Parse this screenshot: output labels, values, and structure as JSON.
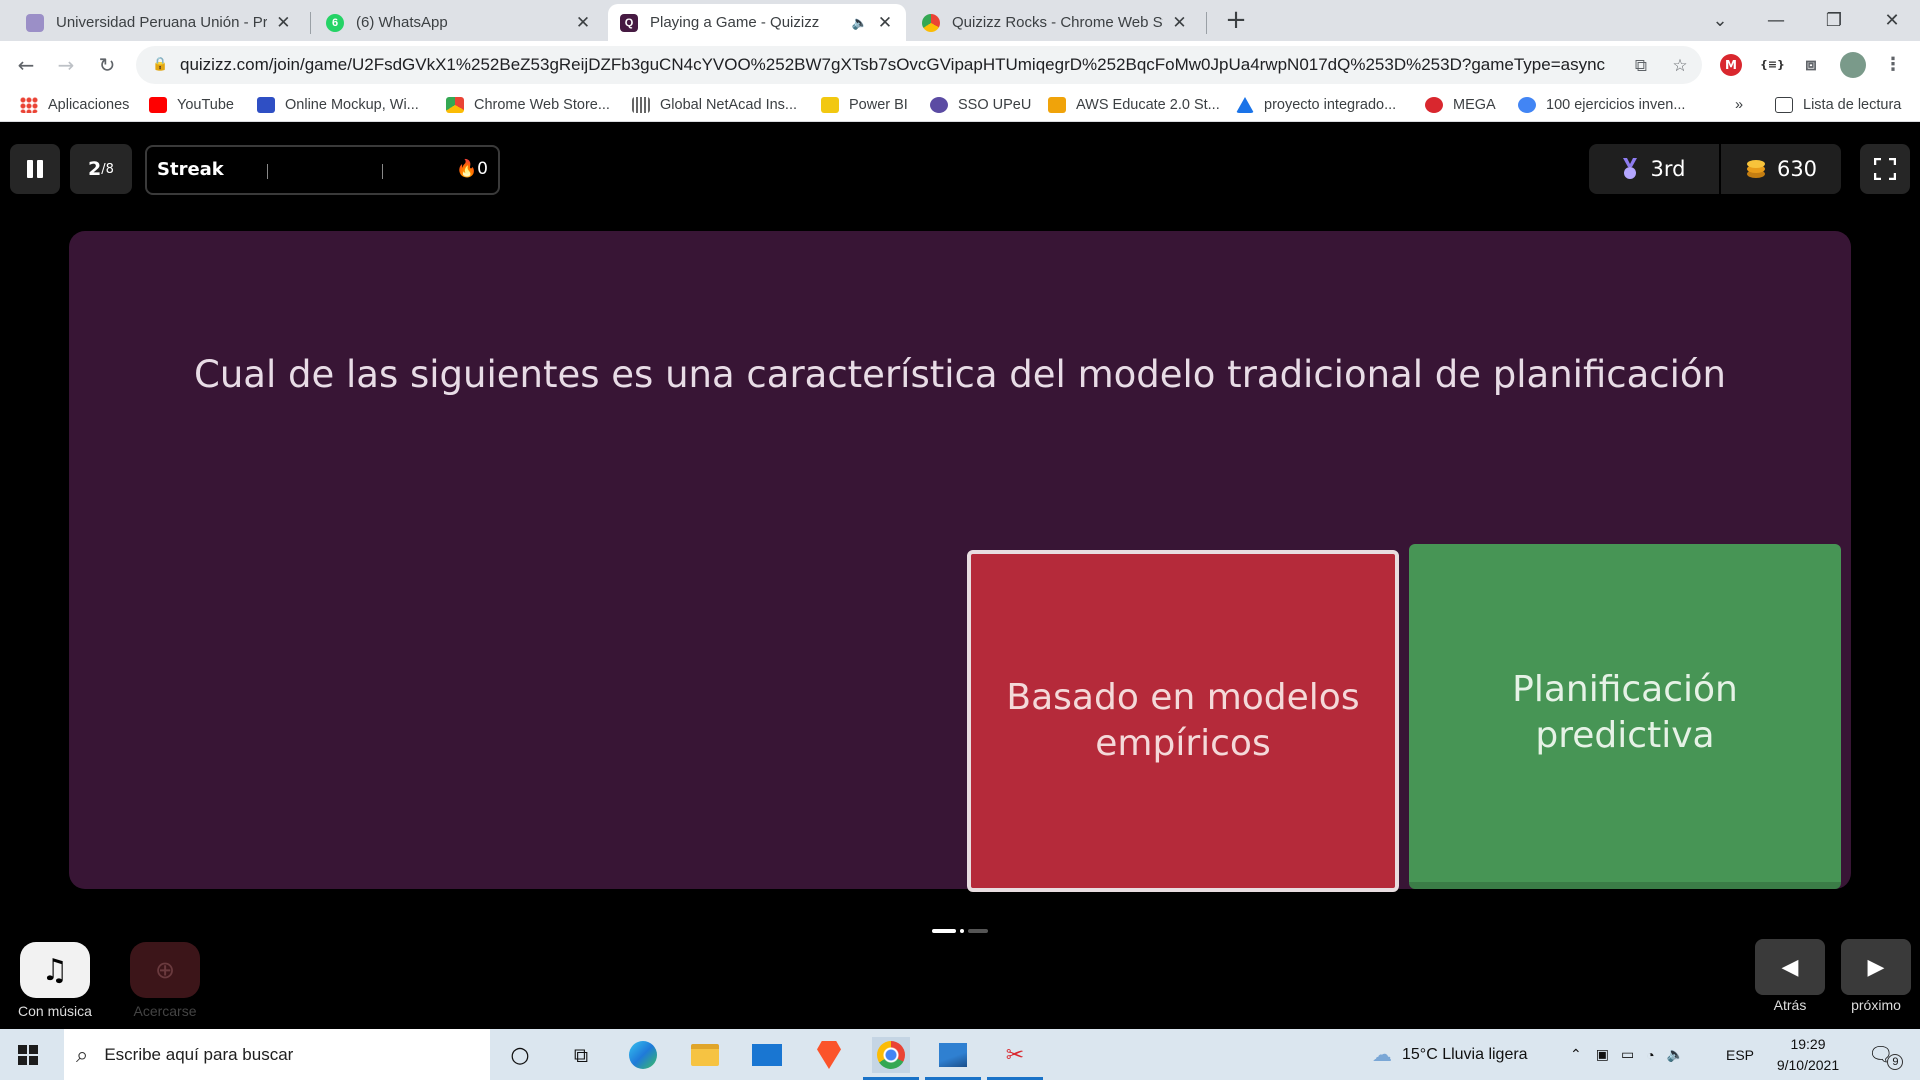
{
  "browser": {
    "tabs": [
      {
        "title": "Universidad Peruana Unión - Pre",
        "favicon_color": "#9b8fc7"
      },
      {
        "title": "(6) WhatsApp",
        "favicon_color": "#25d366"
      },
      {
        "title": "Playing a Game - Quizizz",
        "favicon_color": "#461a42",
        "active": true
      },
      {
        "title": "Quizizz Rocks - Chrome Web Sto",
        "favicon_color": "#e8a33b"
      }
    ],
    "url": "quizizz.com/join/game/U2FsdGVkX1%252BeZ53gReijDZFb3guCN4cYVOO%252BW7gXTsb7sOvcGVipapHTUmiqegrD%252BqcFoMw0JpUa4rwpN017dQ%253D%253D?gameType=async",
    "bookmarks": [
      {
        "label": "Aplicaciones",
        "color": "#ea4335"
      },
      {
        "label": "YouTube",
        "color": "#ff0000"
      },
      {
        "label": "Online Mockup, Wi...",
        "color": "#2f4fc4"
      },
      {
        "label": "Chrome Web Store...",
        "color": "#e8a33b"
      },
      {
        "label": "Global NetAcad Ins...",
        "color": "#666666"
      },
      {
        "label": "Power BI",
        "color": "#f2c811"
      },
      {
        "label": "SSO UPeU",
        "color": "#5b4ba3"
      },
      {
        "label": "AWS Educate 2.0 St...",
        "color": "#f0a30a"
      },
      {
        "label": "proyecto integrado...",
        "color": "#1a73e8"
      },
      {
        "label": "MEGA",
        "color": "#d9272e"
      },
      {
        "label": "100 ejercicios inven...",
        "color": "#4285f4"
      }
    ],
    "bookmarks_overflow": "»",
    "reading_list": "Lista de lectura"
  },
  "game": {
    "question_counter": {
      "current": "2",
      "total": "/8"
    },
    "streak": {
      "label": "Streak",
      "count": "0"
    },
    "rank": "3rd",
    "coins": "630",
    "question": "Cual de las siguientes es una característica del modelo tradicional de planificación",
    "options": [
      {
        "text": "Basado en modelos empíricos",
        "color": "#b52a3a"
      },
      {
        "text": "Planificación predictiva",
        "color": "#479555"
      }
    ],
    "music_label": "Con música",
    "zoom_label": "Acercarse",
    "back_label": "Atrás",
    "next_label": "próximo"
  },
  "taskbar": {
    "search_placeholder": "Escribe aquí para buscar",
    "weather": "15°C  Lluvia ligera",
    "language": "ESP",
    "time": "19:29",
    "date": "9/10/2021",
    "notifications": "9"
  }
}
